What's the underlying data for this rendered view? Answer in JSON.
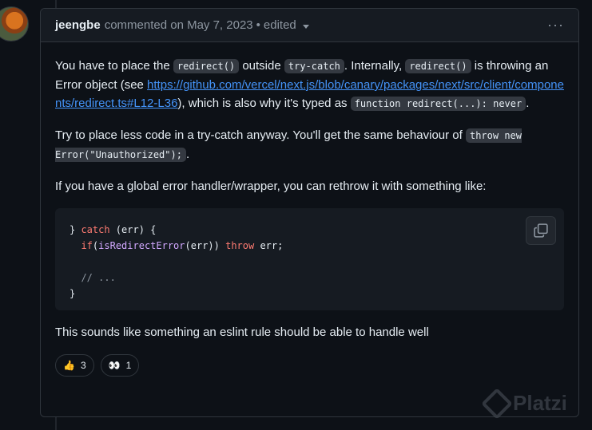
{
  "comment": {
    "author": "jeengbe",
    "meta": "commented on May 7, 2023",
    "separator": "•",
    "edited": "edited",
    "menu": "···"
  },
  "body": {
    "p1": {
      "t1": "You have to place the ",
      "c1": "redirect()",
      "t2": " outside ",
      "c2": "try-catch",
      "t3": ". Internally, ",
      "c3": "redirect()",
      "t4": " is throwing an Error object (see ",
      "link": "https://github.com/vercel/next.js/blob/canary/packages/next/src/client/components/redirect.ts#L12-L36",
      "t5": "), which is also why it's typed as ",
      "c4": "function redirect(...): never",
      "t6": "."
    },
    "p2": {
      "t1": "Try to place less code in a try-catch anyway. You'll get the same behaviour of ",
      "c1": "throw new Error(\"Unauthorized\");",
      "t2": "."
    },
    "p3": "If you have a global error handler/wrapper, you can rethrow it with something like:",
    "code": {
      "l1a": "} ",
      "l1b": "catch",
      "l1c": " (err) {",
      "l2a": "  ",
      "l2b": "if",
      "l2c": "(",
      "l2d": "isRedirectError",
      "l2e": "(err)) ",
      "l2f": "throw",
      "l2g": " err;",
      "l4": "  // ...",
      "l5": "}"
    },
    "p4": "This sounds like something an eslint rule should be able to handle well"
  },
  "reactions": [
    {
      "emoji": "👍",
      "count": "3"
    },
    {
      "emoji": "👀",
      "count": "1"
    }
  ],
  "watermark": "Platzi"
}
